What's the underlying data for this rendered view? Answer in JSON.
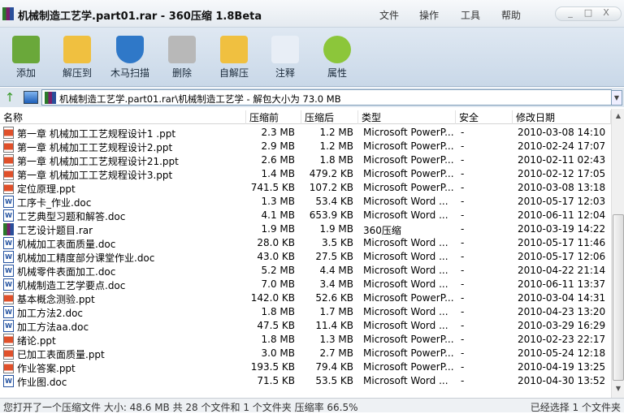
{
  "title": "机械制造工艺学.part01.rar - 360压缩 1.8Beta",
  "menu": [
    "文件",
    "操作",
    "工具",
    "帮助"
  ],
  "window_buttons": [
    "_",
    "□",
    "X"
  ],
  "toolbar": [
    {
      "label": "添加",
      "icon": "add-archive-icon",
      "color": "#6aa83a"
    },
    {
      "label": "解压到",
      "icon": "extract-folder-icon",
      "color": "#f0c040"
    },
    {
      "label": "木马扫描",
      "icon": "shield-scan-icon",
      "color": "#2f78c8"
    },
    {
      "label": "删除",
      "icon": "trash-icon",
      "color": "#b8b8b8"
    },
    {
      "label": "自解压",
      "icon": "self-extract-icon",
      "color": "#f0c040"
    },
    {
      "label": "注释",
      "icon": "comment-edit-icon",
      "color": "#e8eef6"
    },
    {
      "label": "属性",
      "icon": "info-icon",
      "color": "#8cc63a"
    }
  ],
  "address": {
    "path": "机械制造工艺学.part01.rar\\机械制造工艺学 - 解包大小为 73.0 MB",
    "up_icon": "↑"
  },
  "columns": [
    "名称",
    "压缩前",
    "压缩后",
    "类型",
    "安全",
    "修改日期"
  ],
  "files": [
    {
      "name": "第一章 机械加工工艺规程设计1 .ppt",
      "type_icon": "ppt",
      "before": "2.3 MB",
      "after": "1.2 MB",
      "type": "Microsoft PowerP...",
      "safety": "-",
      "date": "2010-03-08 14:10"
    },
    {
      "name": "第一章 机械加工工艺规程设计2.ppt",
      "type_icon": "ppt",
      "before": "2.9 MB",
      "after": "1.2 MB",
      "type": "Microsoft PowerP...",
      "safety": "-",
      "date": "2010-02-24 17:07"
    },
    {
      "name": "第一章 机械加工工艺规程设计21.ppt",
      "type_icon": "ppt",
      "before": "2.6 MB",
      "after": "1.8 MB",
      "type": "Microsoft PowerP...",
      "safety": "-",
      "date": "2010-02-11 02:43"
    },
    {
      "name": "第一章 机械加工工艺规程设计3.ppt",
      "type_icon": "ppt",
      "before": "1.4 MB",
      "after": "479.2 KB",
      "type": "Microsoft PowerP...",
      "safety": "-",
      "date": "2010-02-12 17:05"
    },
    {
      "name": "定位原理.ppt",
      "type_icon": "ppt",
      "before": "741.5 KB",
      "after": "107.2 KB",
      "type": "Microsoft PowerP...",
      "safety": "-",
      "date": "2010-03-08 13:18"
    },
    {
      "name": "工序卡_作业.doc",
      "type_icon": "doc",
      "before": "1.3 MB",
      "after": "53.4 KB",
      "type": "Microsoft Word ...",
      "safety": "-",
      "date": "2010-05-17 12:03"
    },
    {
      "name": "工艺典型习题和解答.doc",
      "type_icon": "doc",
      "before": "4.1 MB",
      "after": "653.9 KB",
      "type": "Microsoft Word ...",
      "safety": "-",
      "date": "2010-06-11 12:04"
    },
    {
      "name": "工艺设计题目.rar",
      "type_icon": "rar",
      "before": "1.9 MB",
      "after": "1.9 MB",
      "type": "360压缩",
      "safety": "-",
      "date": "2010-03-19 14:22"
    },
    {
      "name": "机械加工表面质量.doc",
      "type_icon": "doc",
      "before": "28.0 KB",
      "after": "3.5 KB",
      "type": "Microsoft Word ...",
      "safety": "-",
      "date": "2010-05-17 11:46"
    },
    {
      "name": "机械加工精度部分课堂作业.doc",
      "type_icon": "doc",
      "before": "43.0 KB",
      "after": "27.5 KB",
      "type": "Microsoft Word ...",
      "safety": "-",
      "date": "2010-05-17 12:06"
    },
    {
      "name": "机械零件表面加工.doc",
      "type_icon": "doc",
      "before": "5.2 MB",
      "after": "4.4 MB",
      "type": "Microsoft Word ...",
      "safety": "-",
      "date": "2010-04-22 21:14"
    },
    {
      "name": "机械制造工艺学要点.doc",
      "type_icon": "doc",
      "before": "7.0 MB",
      "after": "3.4 MB",
      "type": "Microsoft Word ...",
      "safety": "-",
      "date": "2010-06-11 13:37"
    },
    {
      "name": "基本概念测验.ppt",
      "type_icon": "ppt",
      "before": "142.0 KB",
      "after": "52.6 KB",
      "type": "Microsoft PowerP...",
      "safety": "-",
      "date": "2010-03-04 14:31"
    },
    {
      "name": "加工方法2.doc",
      "type_icon": "doc",
      "before": "1.8 MB",
      "after": "1.7 MB",
      "type": "Microsoft Word ...",
      "safety": "-",
      "date": "2010-04-23 13:20"
    },
    {
      "name": "加工方法aa.doc",
      "type_icon": "doc",
      "before": "47.5 KB",
      "after": "11.4 KB",
      "type": "Microsoft Word ...",
      "safety": "-",
      "date": "2010-03-29 16:29"
    },
    {
      "name": "绪论.ppt",
      "type_icon": "ppt",
      "before": "1.8 MB",
      "after": "1.3 MB",
      "type": "Microsoft PowerP...",
      "safety": "-",
      "date": "2010-02-23 22:17"
    },
    {
      "name": "已加工表面质量.ppt",
      "type_icon": "ppt",
      "before": "3.0 MB",
      "after": "2.7 MB",
      "type": "Microsoft PowerP...",
      "safety": "-",
      "date": "2010-05-24 12:18"
    },
    {
      "name": "作业答案.ppt",
      "type_icon": "ppt",
      "before": "193.5 KB",
      "after": "79.4 KB",
      "type": "Microsoft PowerP...",
      "safety": "-",
      "date": "2010-04-19 13:25"
    },
    {
      "name": "作业图.doc",
      "type_icon": "doc",
      "before": "71.5 KB",
      "after": "53.5 KB",
      "type": "Microsoft Word ...",
      "safety": "-",
      "date": "2010-04-30 13:52"
    }
  ],
  "status": {
    "left": "您打开了一个压缩文件 大小: 48.6 MB 共 28 个文件和 1 个文件夹 压缩率 66.5%",
    "right": "已经选择 1 个文件夹"
  }
}
